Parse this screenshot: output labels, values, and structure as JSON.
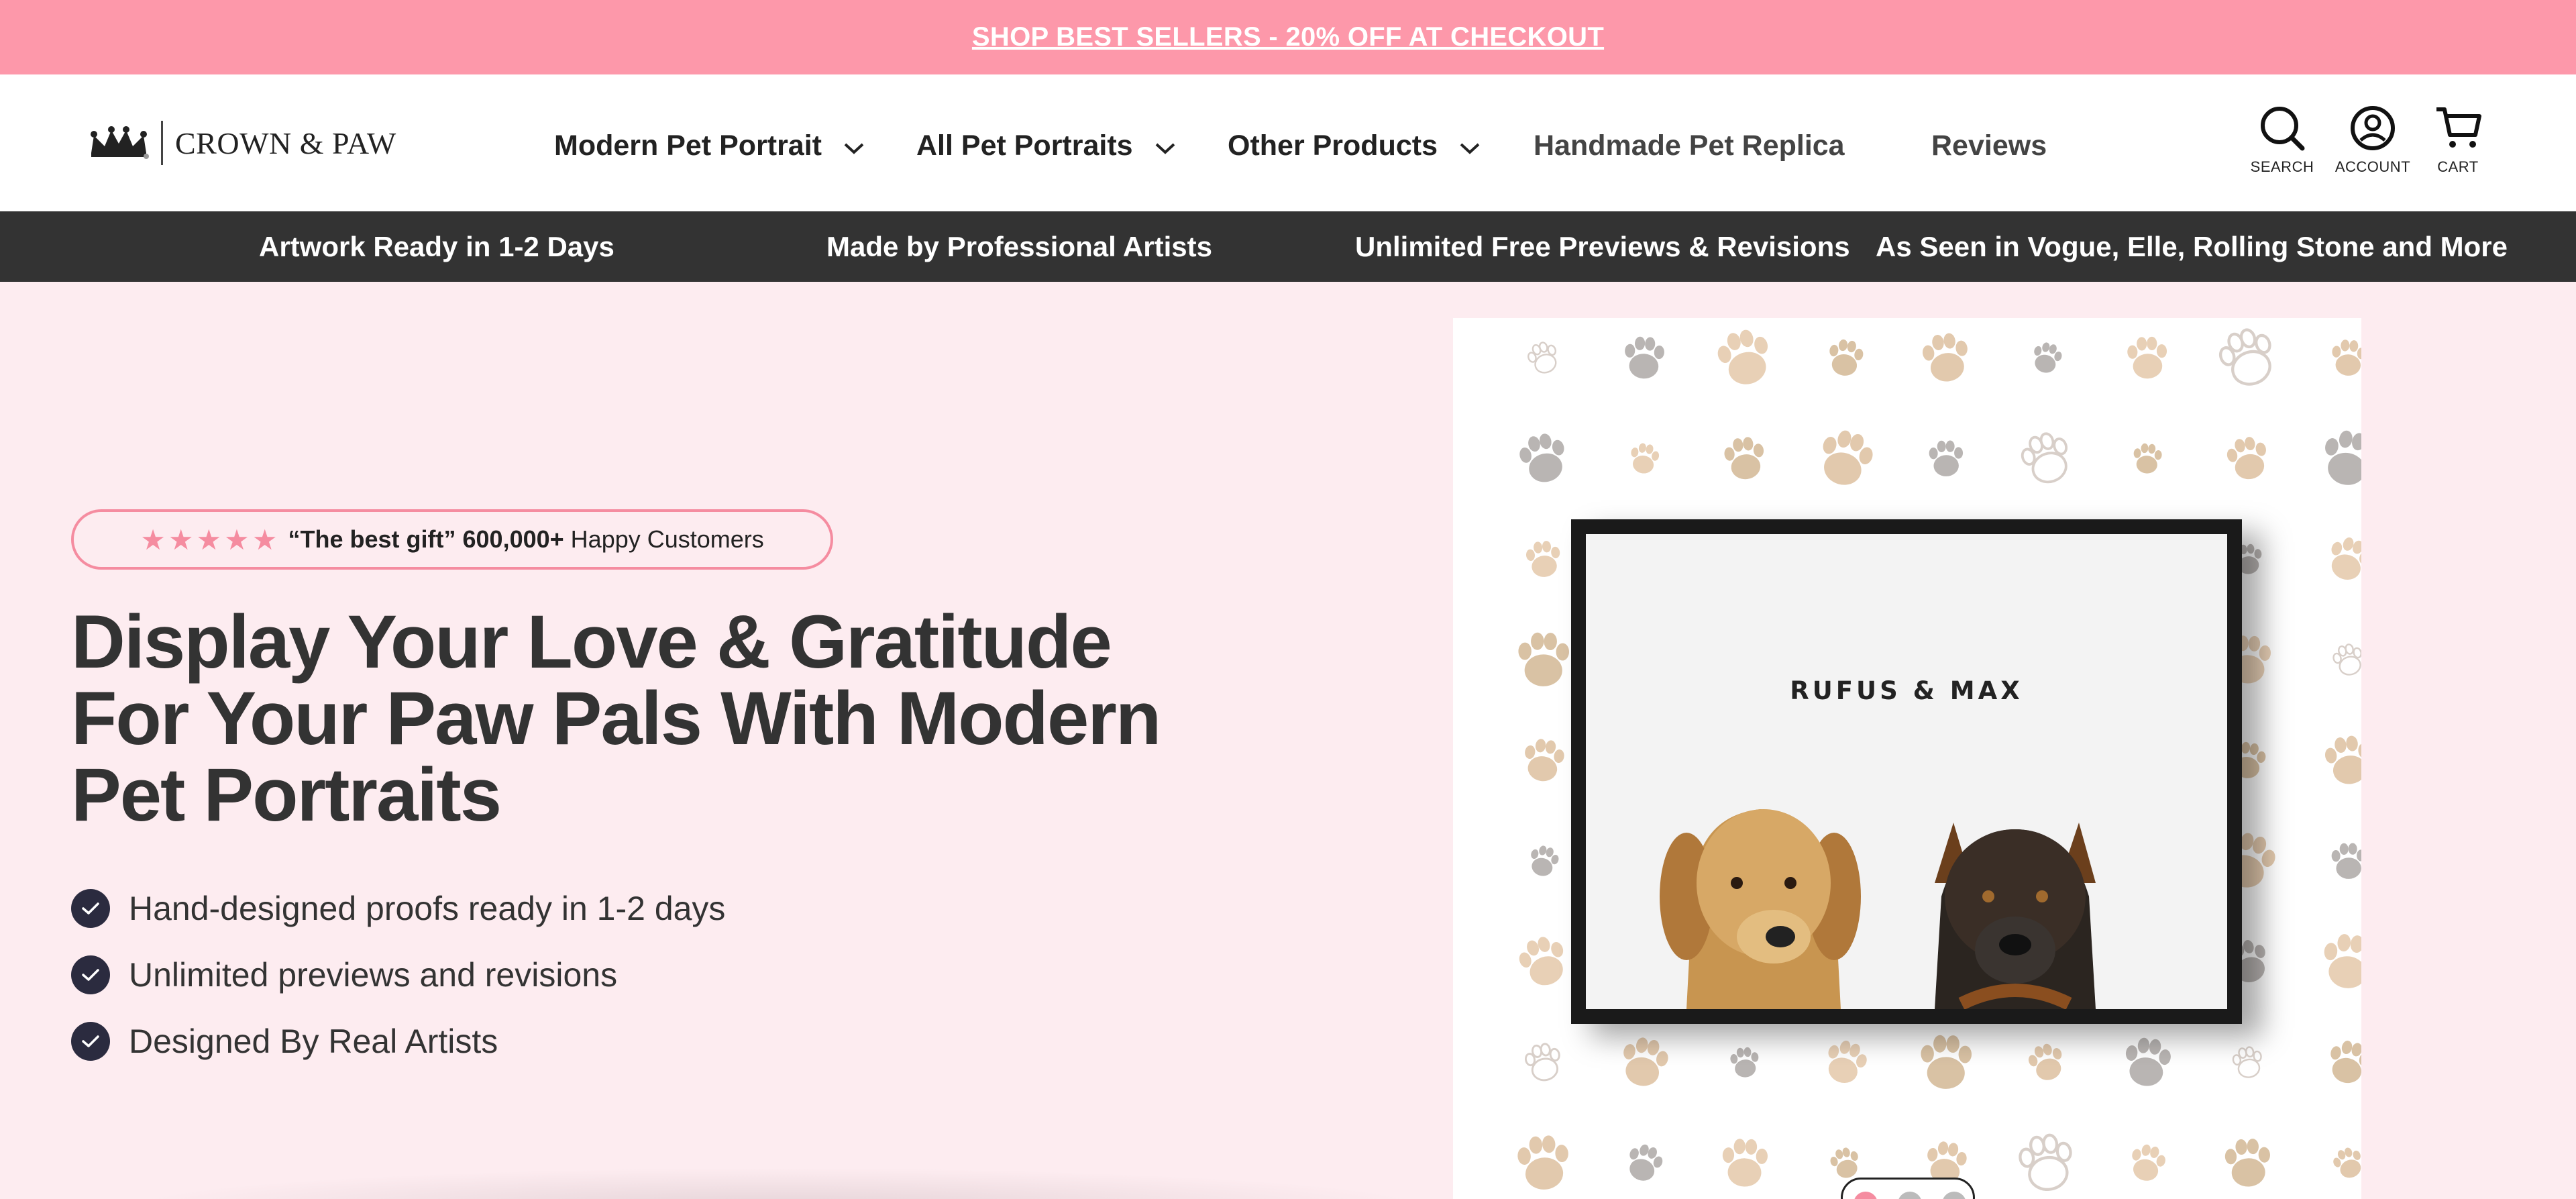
{
  "announcement": {
    "text": "SHOP BEST SELLERS - 20% OFF AT CHECKOUT"
  },
  "brand": {
    "name": "CROWN & PAW",
    "logo_icon": "crown-icon"
  },
  "nav": {
    "items": [
      {
        "label": "Modern Pet Portrait",
        "has_dropdown": true
      },
      {
        "label": "All Pet Portraits",
        "has_dropdown": true
      },
      {
        "label": "Other Products",
        "has_dropdown": true
      },
      {
        "label": "Handmade Pet Replica",
        "has_dropdown": false
      },
      {
        "label": "Reviews",
        "has_dropdown": false
      }
    ]
  },
  "header_icons": {
    "search": {
      "label": "SEARCH",
      "icon": "search-icon"
    },
    "account": {
      "label": "ACCOUNT",
      "icon": "account-icon"
    },
    "cart": {
      "label": "CART",
      "icon": "cart-icon"
    }
  },
  "usp": [
    "Artwork Ready in 1-2 Days",
    "Made by Professional Artists",
    "Unlimited Free Previews & Revisions",
    "As Seen in Vogue, Elle, Rolling Stone and More"
  ],
  "hero": {
    "rating": {
      "stars": 5,
      "quote": "“The best gift”",
      "count": "600,000+",
      "suffix": "Happy Customers"
    },
    "title": "Display Your Love & Gratitude For Your Paw Pals With Modern Pet Portraits",
    "features": [
      "Hand-designed proofs ready in 1-2 days",
      "Unlimited previews and revisions",
      "Designed By Real Artists"
    ],
    "portrait_names": "RUFUS & MAX",
    "carousel": {
      "slides": 3,
      "active": 1
    }
  },
  "colors": {
    "announcement_bg": "#fd98aa",
    "usp_bg": "#333333",
    "hero_bg": "#fdecf0",
    "accent_pink": "#f58ca0",
    "check_bg": "#2b2b3f"
  }
}
